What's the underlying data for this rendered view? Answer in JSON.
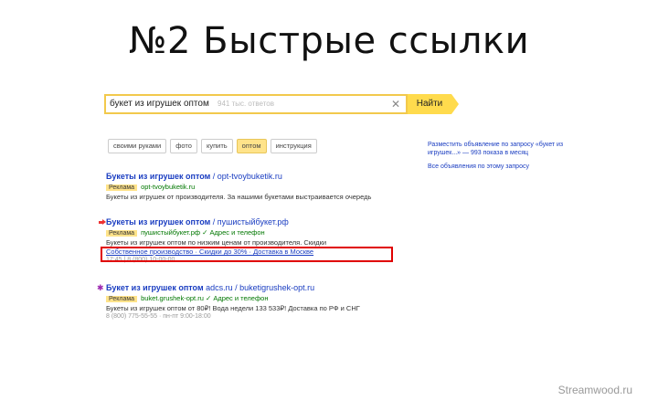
{
  "slide": {
    "title": "№2 Быстрые ссылки",
    "watermark": "Streamwood.ru"
  },
  "search": {
    "query": "букет из игрушек оптом",
    "count": "941 тыс. ответов",
    "button": "Найти",
    "clear_icon": "close-icon"
  },
  "chips": [
    {
      "label": "своими руками",
      "active": false
    },
    {
      "label": "фото",
      "active": false
    },
    {
      "label": "купить",
      "active": false
    },
    {
      "label": "оптом",
      "active": true
    },
    {
      "label": "инструкция",
      "active": false
    }
  ],
  "sidebar": {
    "ad_text": "Разместить объявление по запросу «букет из игрушек...» — 993 показа в месяц",
    "ads_link": "Все объявления по этому запросу"
  },
  "results": [
    {
      "title": "Букеты из игрушек оптом",
      "title_tail": " / opt-tvoybuketik.ru",
      "badge": "Реклама",
      "url": "opt-tvoybuketik.ru",
      "text": "Букеты из игрушек от производителя. За нашими букетами выстраивается очередь",
      "meta": "",
      "links": ""
    },
    {
      "title": "Букеты из игрушек оптом",
      "title_tail": " / пушистыйбукет.рф",
      "badge": "Реклама",
      "url": "пушистыйбукет.рф  ✓ Адрес и телефон",
      "text": "Букеты из игрушек оптом по низким ценам от производителя. Скидки",
      "links": "Собственное производство · Скидки до 30% · Доставка в Москве",
      "meta": "17:45 | 8 (800) 10-00-00"
    },
    {
      "title": "Букет из игрушек оптом",
      "title_tail": " adcs.ru / buketigrushek-opt.ru",
      "badge": "Реклама",
      "url": "buket.grushek-opt.ru  ✓ Адрес и телефон",
      "text": "Букеты из игрушек оптом от 80₽! Вода недели 133 533₽! Доставка по РФ и СНГ",
      "meta": "8 (800) 775-55-55 · пн-пт 9:00-18:00",
      "links": ""
    }
  ]
}
